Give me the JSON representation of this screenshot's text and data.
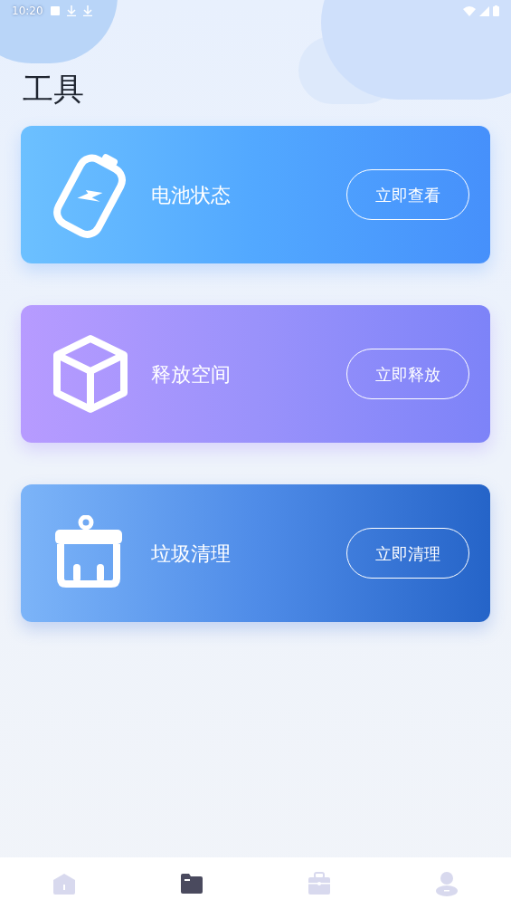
{
  "status_bar": {
    "time": "10:20"
  },
  "title": "工具",
  "cards": [
    {
      "kind": "battery",
      "label": "电池状态",
      "button": "立即查看"
    },
    {
      "kind": "box",
      "label": "释放空间",
      "button": "立即释放"
    },
    {
      "kind": "basket",
      "label": "垃圾清理",
      "button": "立即清理"
    }
  ],
  "nav": [
    {
      "kind": "home",
      "selected": false
    },
    {
      "kind": "folder",
      "selected": true
    },
    {
      "kind": "briefcase",
      "selected": false
    },
    {
      "kind": "person",
      "selected": false
    }
  ]
}
